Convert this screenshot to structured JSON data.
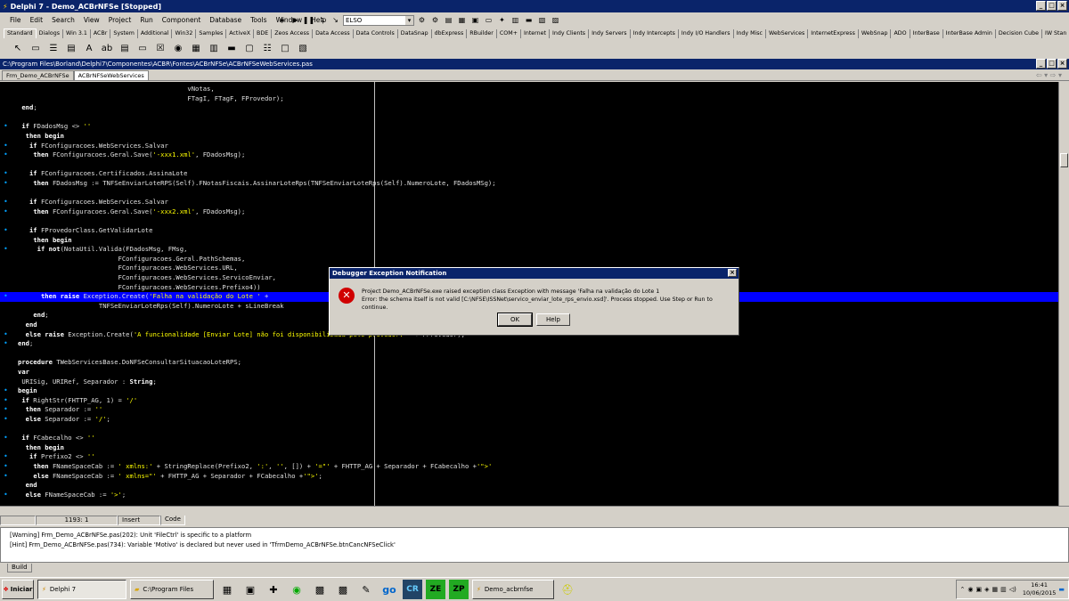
{
  "window": {
    "title": "Delphi 7 - Demo_ACBrNFSe [Stopped]"
  },
  "menu": [
    "File",
    "Edit",
    "Search",
    "View",
    "Project",
    "Run",
    "Component",
    "Database",
    "Tools",
    "Window",
    "Help"
  ],
  "toolbar": {
    "combo_value": "ELSO"
  },
  "palette_tabs": [
    "Standard",
    "Dialogs",
    "Win 3.1",
    "ACBr",
    "System",
    "Additional",
    "Win32",
    "Samples",
    "ActiveX",
    "BDE",
    "Zeos Access",
    "Data Access",
    "Data Controls",
    "DataSnap",
    "dbExpress",
    "RBuilder",
    "COM+",
    "Internet",
    "Indy Clients",
    "Indy Servers",
    "Indy Intercepts",
    "Indy I/O Handlers",
    "Indy Misc",
    "WebServices",
    "InternetExpress",
    "WebSnap",
    "ADO",
    "InterBase",
    "InterBase Admin",
    "Decision Cube",
    "IW Stan"
  ],
  "editor": {
    "path": "C:\\Program Files\\Borland\\Delphi7\\Componentes\\ACBR\\Fontes\\ACBrNFSe\\ACBrNFSeWebServices.pas",
    "tabs": [
      "Frm_Demo_ACBrNFSe",
      "ACBrNFSeWebServices"
    ],
    "lines": [
      {
        "dot": false,
        "text": "                                            vNotas,"
      },
      {
        "dot": false,
        "text": "                                            FTagI, FTagF, FProvedor);"
      },
      {
        "dot": false,
        "text": " end;"
      },
      {
        "dot": false,
        "text": ""
      },
      {
        "dot": true,
        "text": " if FDadosMsg <> ''"
      },
      {
        "dot": false,
        "text": "  then begin"
      },
      {
        "dot": true,
        "text": "   if FConfiguracoes.WebServices.Salvar"
      },
      {
        "dot": true,
        "text": "    then FConfiguracoes.Geral.Save('-xxx1.xml', FDadosMsg);"
      },
      {
        "dot": false,
        "text": ""
      },
      {
        "dot": true,
        "text": "   if FConfiguracoes.Certificados.AssinaLote"
      },
      {
        "dot": true,
        "text": "    then FDadosMsg := TNFSeEnviarLoteRPS(Self).FNotasFiscais.AssinarLoteRps(TNFSeEnviarLoteRps(Self).NumeroLote, FDadosMSg);"
      },
      {
        "dot": false,
        "text": ""
      },
      {
        "dot": true,
        "text": "   if FConfiguracoes.WebServices.Salvar"
      },
      {
        "dot": true,
        "text": "    then FConfiguracoes.Geral.Save('-xxx2.xml', FDadosMsg);"
      },
      {
        "dot": false,
        "text": ""
      },
      {
        "dot": true,
        "text": "   if FProvedorClass.GetValidarLote"
      },
      {
        "dot": false,
        "text": "    then begin"
      },
      {
        "dot": true,
        "text": "     if not(NotaUtil.Valida(FDadosMsg, FMsg,"
      },
      {
        "dot": false,
        "text": "                          FConfiguracoes.Geral.PathSchemas,"
      },
      {
        "dot": false,
        "text": "                          FConfiguracoes.WebServices.URL,"
      },
      {
        "dot": false,
        "text": "                          FConfiguracoes.WebServices.ServicoEnviar,"
      },
      {
        "dot": false,
        "text": "                          FConfiguracoes.WebServices.Prefixo4))"
      },
      {
        "dot": true,
        "hl": true,
        "text": "      then raise Exception.Create('Falha na validação do Lote ' +"
      },
      {
        "dot": false,
        "text": "                     TNFSeEnviarLoteRps(Self).NumeroLote + sLineBreak"
      },
      {
        "dot": false,
        "text": "    end;"
      },
      {
        "dot": false,
        "text": "  end"
      },
      {
        "dot": true,
        "text": "  else raise Exception.Create('A funcionalidade [Enviar Lote] não foi disponibilizada pelo provedor: ' + FProvedor);"
      },
      {
        "dot": true,
        "text": "end;"
      },
      {
        "dot": false,
        "text": ""
      },
      {
        "dot": false,
        "text": "procedure TWebServicesBase.DoNFSeConsultarSituacaoLoteRPS;"
      },
      {
        "dot": false,
        "text": "var"
      },
      {
        "dot": false,
        "text": " URISig, URIRef, Separador : String;"
      },
      {
        "dot": true,
        "text": "begin"
      },
      {
        "dot": true,
        "text": " if RightStr(FHTTP_AG, 1) = '/'"
      },
      {
        "dot": true,
        "text": "  then Separador := ''"
      },
      {
        "dot": true,
        "text": "  else Separador := '/';"
      },
      {
        "dot": false,
        "text": ""
      },
      {
        "dot": true,
        "text": " if FCabecalho <> ''"
      },
      {
        "dot": false,
        "text": "  then begin"
      },
      {
        "dot": true,
        "text": "   if Prefixo2 <> ''"
      },
      {
        "dot": true,
        "text": "    then FNameSpaceCab := ' xmlns:' + StringReplace(Prefixo2, ':', '', []) + '=\"' + FHTTP_AG + Separador + FCabecalho +'\">'"
      },
      {
        "dot": true,
        "text": "    else FNameSpaceCab := ' xmlns=\"' + FHTTP_AG + Separador + FCabecalho +'\">';"
      },
      {
        "dot": false,
        "text": "  end"
      },
      {
        "dot": true,
        "text": "  else FNameSpaceCab := '>';"
      }
    ]
  },
  "status": {
    "position": "1193:  1",
    "mode": "Insert",
    "tab": "Code"
  },
  "messages": [
    "[Warning] Frm_Demo_ACBrNFSe.pas(202): Unit 'FileCtrl' is specific to a platform",
    "[Hint] Frm_Demo_ACBrNFSe.pas(734): Variable 'Motivo' is declared but never used in 'TfrmDemo_ACBrNFSe.btnCancNFSeClick'"
  ],
  "build_tab": "Build",
  "dialog": {
    "title": "Debugger Exception Notification",
    "line1": "Project Demo_ACBrNFSe.exe raised exception class Exception with message 'Falha na validação do Lote 1",
    "line2": "Error: the schema itself is not valid [C:\\NFSE\\ISSNet\\servico_enviar_lote_rps_envio.xsd]'. Process stopped. Use Step or Run to continue.",
    "ok": "OK",
    "help": "Help"
  },
  "taskbar": {
    "start": "Iniciar",
    "tasks": [
      "Delphi 7",
      "C:\\Program Files",
      "Demo_acbrnfse"
    ],
    "clock_time": "16:41",
    "clock_date": "10/06/2015"
  }
}
